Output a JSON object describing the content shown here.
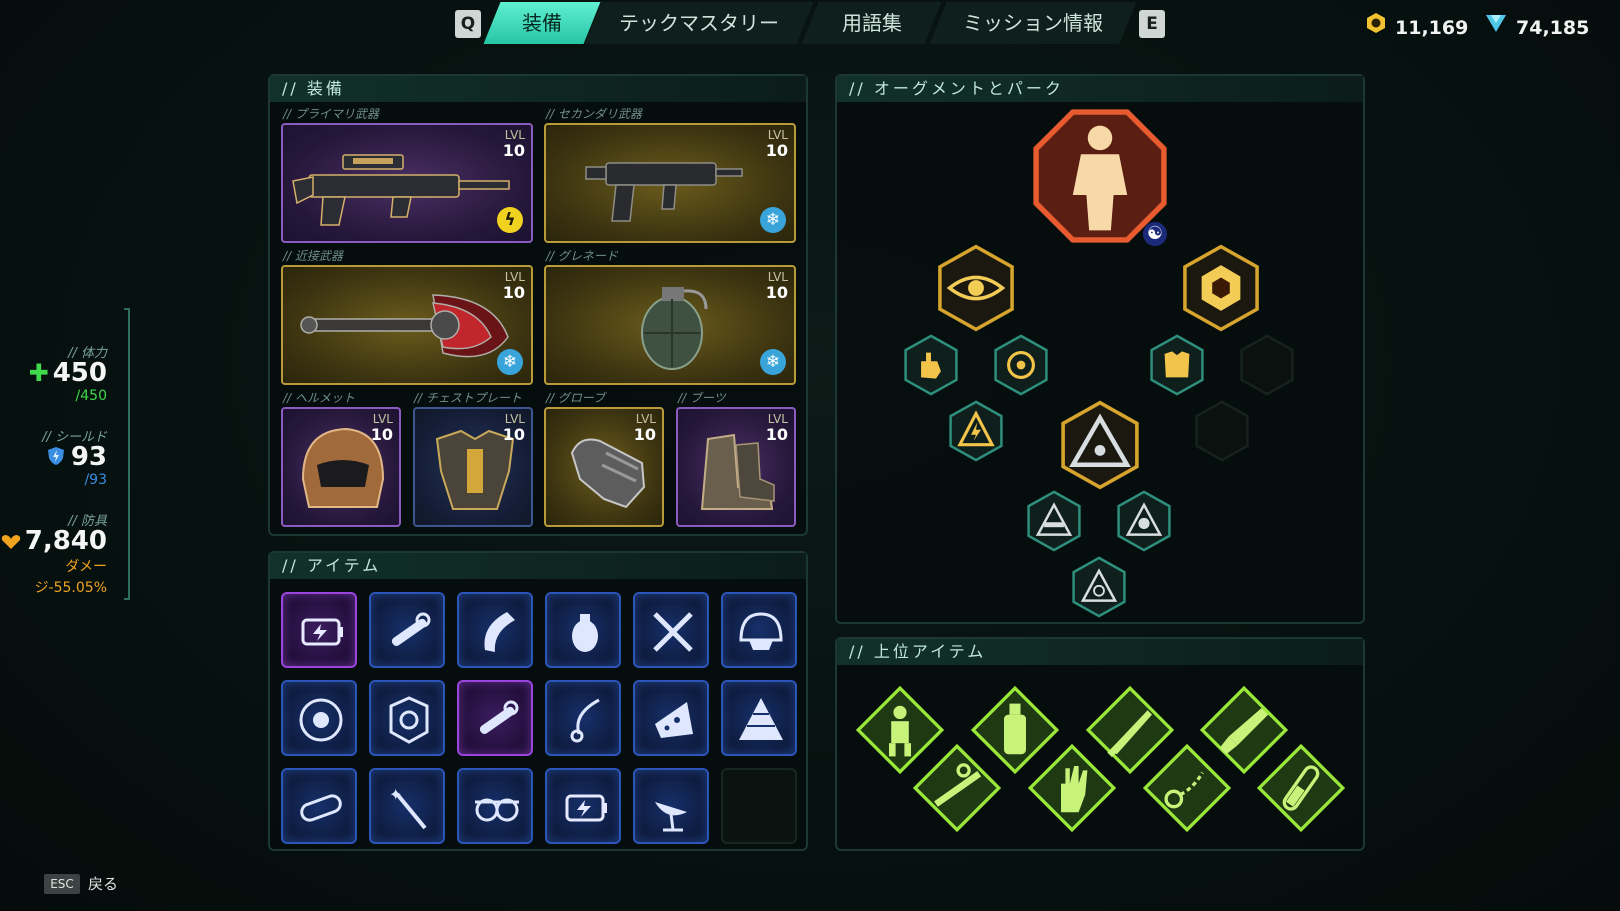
{
  "topbar": {
    "key_left": "Q",
    "key_right": "E",
    "tabs": [
      {
        "label": "装備",
        "active": true
      },
      {
        "label": "テックマスタリー",
        "active": false
      },
      {
        "label": "用語集",
        "active": false
      },
      {
        "label": "ミッション情報",
        "active": false
      }
    ],
    "currency_gold": "11,169",
    "currency_crystal": "74,185"
  },
  "stats": {
    "health_label": "// 体力",
    "health_value": "450",
    "health_max": "/450",
    "shield_label": "// シールド",
    "shield_value": "93",
    "shield_max": "/93",
    "armor_label": "// 防具",
    "armor_value": "7,840",
    "armor_sub1": "ダメー",
    "armor_sub2": "ジ-55.05%"
  },
  "equipment": {
    "title": "// 装備",
    "lvl_label": "LVL",
    "slots": [
      {
        "label": "// プライマリ武器",
        "level": "10",
        "rarity": "purple",
        "element": "bolt-icon"
      },
      {
        "label": "// セカンダリ武器",
        "level": "10",
        "rarity": "gold",
        "element": "frost-icon"
      },
      {
        "label": "// 近接武器",
        "level": "10",
        "rarity": "gold",
        "element": "frost-icon"
      },
      {
        "label": "// グレネード",
        "level": "10",
        "rarity": "gold",
        "element": "frost-icon"
      },
      {
        "label": "// ヘルメット",
        "level": "10",
        "rarity": "purple"
      },
      {
        "label": "// チェストプレート",
        "level": "10",
        "rarity": "blue"
      },
      {
        "label": "// グローブ",
        "level": "10",
        "rarity": "gold"
      },
      {
        "label": "// ブーツ",
        "level": "10",
        "rarity": "purple"
      }
    ]
  },
  "items": {
    "title": "// アイテム",
    "list": [
      {
        "icon": "battery-icon",
        "rarity": "purple"
      },
      {
        "icon": "scope-icon",
        "rarity": "blue"
      },
      {
        "icon": "magazine-icon",
        "rarity": "blue"
      },
      {
        "icon": "grenade-icon",
        "rarity": "blue"
      },
      {
        "icon": "crossed-swords-icon",
        "rarity": "blue"
      },
      {
        "icon": "helmet-icon",
        "rarity": "blue"
      },
      {
        "icon": "disc-icon",
        "rarity": "blue"
      },
      {
        "icon": "armor-plate-icon",
        "rarity": "blue"
      },
      {
        "icon": "scope-icon",
        "rarity": "purple"
      },
      {
        "icon": "lanyard-icon",
        "rarity": "blue"
      },
      {
        "icon": "cheese-icon",
        "rarity": "blue"
      },
      {
        "icon": "food-pyramid-icon",
        "rarity": "blue"
      },
      {
        "icon": "canister-icon",
        "rarity": "blue"
      },
      {
        "icon": "wand-icon",
        "rarity": "blue"
      },
      {
        "icon": "goggles-icon",
        "rarity": "blue"
      },
      {
        "icon": "battery-icon",
        "rarity": "blue"
      },
      {
        "icon": "satellite-dish-icon",
        "rarity": "blue"
      },
      {
        "icon": "",
        "rarity": "empty"
      }
    ]
  },
  "augments": {
    "title": "// オーグメントとパーク",
    "nodes": [
      {
        "icon": "armored-soldier-icon",
        "tier": "main"
      },
      {
        "icon": "eye-icon",
        "tier": "gold"
      },
      {
        "icon": "core-icon",
        "tier": "gold"
      },
      {
        "icon": "hand-spark-icon",
        "tier": "teal"
      },
      {
        "icon": "vortex-icon",
        "tier": "teal"
      },
      {
        "icon": "vest-icon",
        "tier": "teal"
      },
      {
        "icon": "",
        "tier": "empty"
      },
      {
        "icon": "warning-bolt-icon",
        "tier": "teal"
      },
      {
        "icon": "tri-blade-icon",
        "tier": "gold"
      },
      {
        "icon": "",
        "tier": "empty"
      },
      {
        "icon": "gun-triangle-icon",
        "tier": "teal"
      },
      {
        "icon": "skull-triangle-icon",
        "tier": "teal"
      },
      {
        "icon": "target-triangle-icon",
        "tier": "teal"
      }
    ]
  },
  "top_items": {
    "title": "// 上位アイテム",
    "list": [
      {
        "icon": "robot-figure-icon"
      },
      {
        "icon": "bottle-icon"
      },
      {
        "icon": "knife-icon"
      },
      {
        "icon": "rocket-icon"
      },
      {
        "icon": "rifle-icon"
      },
      {
        "icon": "hand-icon"
      },
      {
        "icon": "chain-icon"
      },
      {
        "icon": "test-tube-icon"
      }
    ]
  },
  "footer": {
    "esc_key": "ESC",
    "back_label": "戻る"
  },
  "colors": {
    "accent": "#3fe0bf",
    "gold": "#f0b73a",
    "teal_hex": "#2e8f7c",
    "item_green": "#9be83a",
    "health_green": "#3fd94b",
    "shield_blue": "#3a8de0",
    "armor_orange": "#f0a31f"
  }
}
